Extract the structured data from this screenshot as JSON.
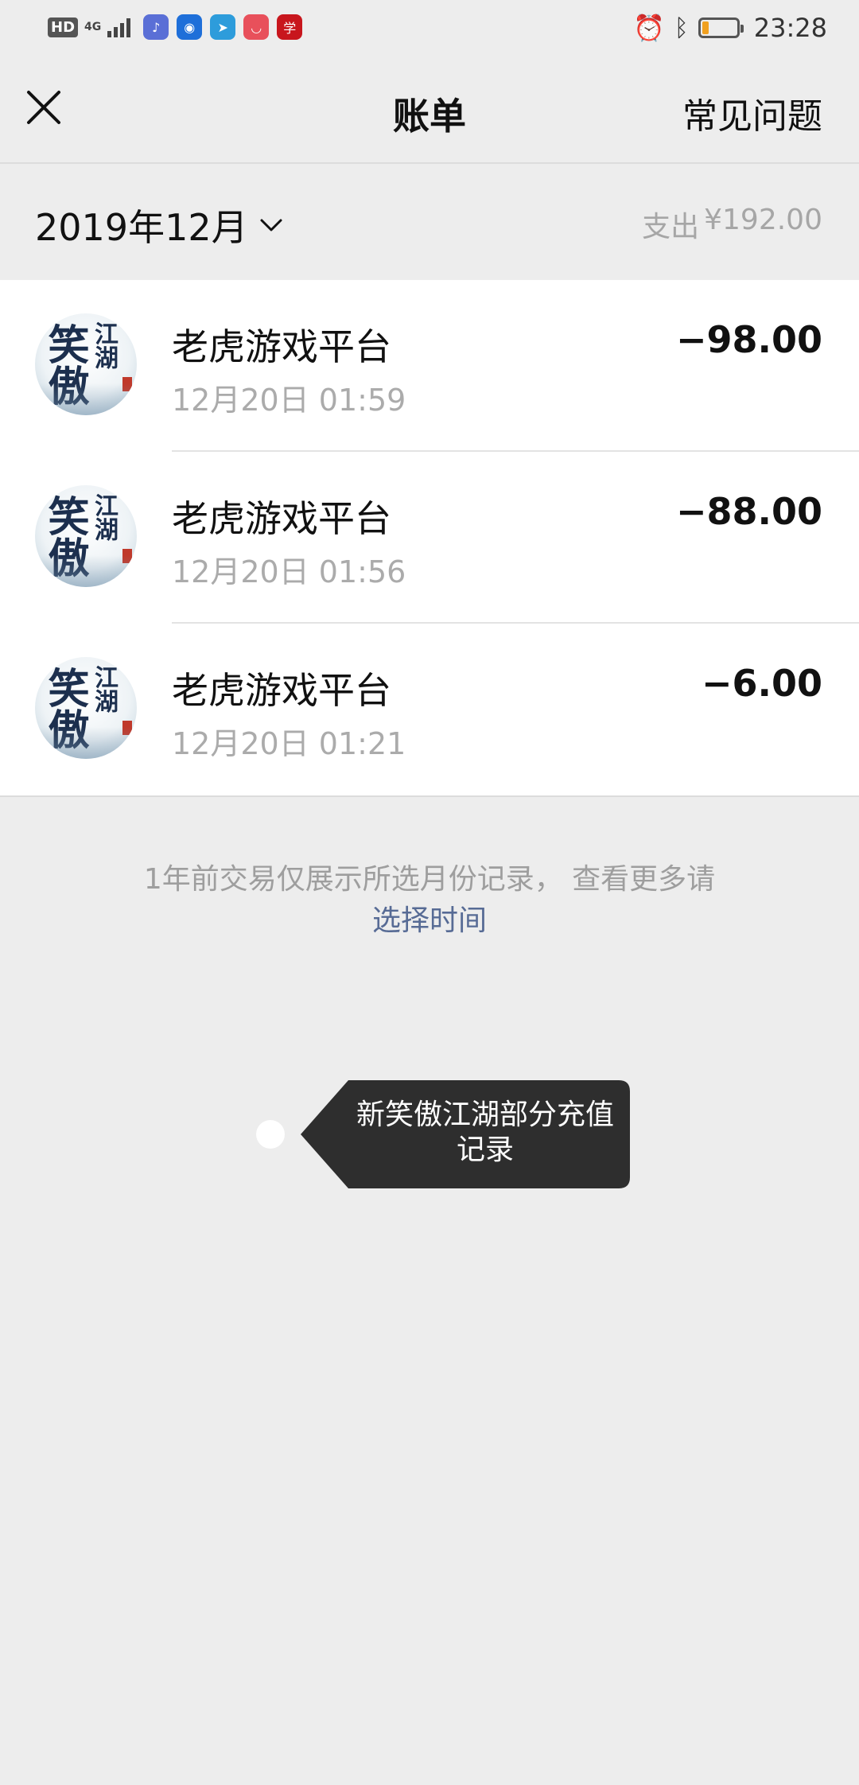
{
  "status_bar": {
    "hd": "HD",
    "network": "4G",
    "network_sub": "4G",
    "time": "23:28",
    "battery_level": 0.2,
    "app_icons": [
      {
        "name": "music-app-icon",
        "color": "#5a6fd6",
        "glyph": "♪"
      },
      {
        "name": "bulb-app-icon",
        "color": "#1e6fd9",
        "glyph": "◉"
      },
      {
        "name": "bird-app-icon",
        "color": "#2d9cdb",
        "glyph": "➤"
      },
      {
        "name": "huawei-mall-app-icon",
        "color": "#e8505b",
        "glyph": "◡"
      },
      {
        "name": "study-app-icon",
        "color": "#c8161d",
        "glyph": "学"
      }
    ]
  },
  "nav": {
    "title": "账单",
    "faq": "常见问题"
  },
  "month": {
    "selected": "2019年12月",
    "expense_label": "支出",
    "expense_amount": "¥192.00"
  },
  "transactions": [
    {
      "merchant": "老虎游戏平台",
      "time": "12月20日 01:59",
      "amount": "−98.00"
    },
    {
      "merchant": "老虎游戏平台",
      "time": "12月20日 01:56",
      "amount": "−88.00"
    },
    {
      "merchant": "老虎游戏平台",
      "time": "12月20日 01:21",
      "amount": "−6.00"
    }
  ],
  "avatar": {
    "text_big": "笑傲",
    "text_small": "江湖"
  },
  "note": {
    "text": "1年前交易仅展示所选月份记录， 查看更多请",
    "link": "选择时间"
  },
  "tooltip": {
    "text": "新笑傲江湖部分充值记录"
  },
  "colors": {
    "background": "#ededed",
    "link": "#576b95",
    "muted": "#ababab",
    "tooltip_bg": "#2e2e2e"
  }
}
